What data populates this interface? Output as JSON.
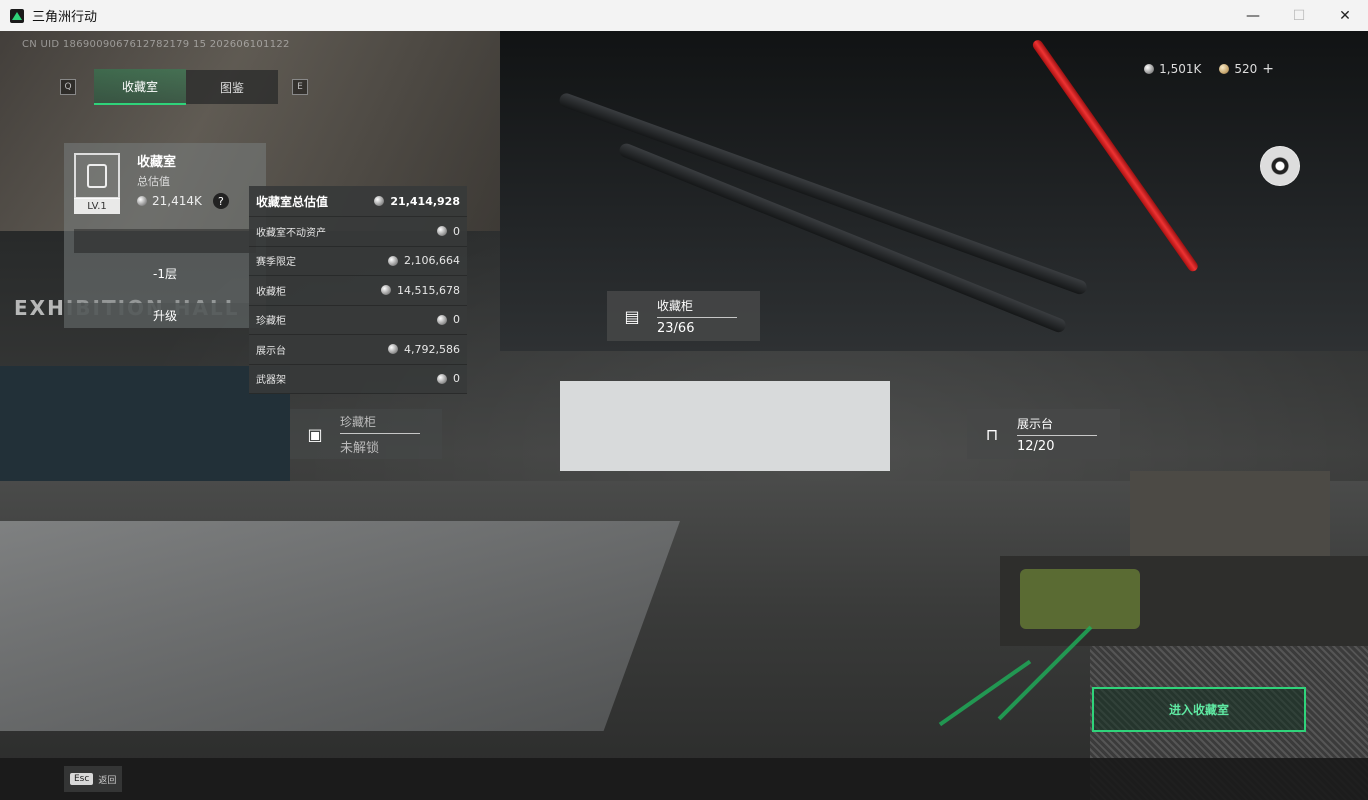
{
  "window": {
    "title": "三角洲行动"
  },
  "uid": "CN UID 1869009067612782179 15 202606101122",
  "currency": {
    "silver": "1,501K",
    "gold": "520",
    "add": "+"
  },
  "tabs": {
    "left_key": "Q",
    "items": [
      "收藏室",
      "图鉴"
    ],
    "right_key": "E",
    "active": 0
  },
  "vault": {
    "title": "收藏室",
    "subtitle": "总估值",
    "level": "LV.1",
    "value": "21,414K",
    "help": "?",
    "progress": 0.0,
    "floor": "-1层",
    "upgrade": "升级"
  },
  "valuation": {
    "title": "收藏室总估值",
    "total": "21,414,928",
    "rows": [
      {
        "label": "收藏室不动资产",
        "value": "0"
      },
      {
        "label": "赛季限定",
        "value": "2,106,664"
      },
      {
        "label": "收藏柜",
        "value": "14,515,678"
      },
      {
        "label": "珍藏柜",
        "value": "0"
      },
      {
        "label": "展示台",
        "value": "4,792,586"
      },
      {
        "label": "武器架",
        "value": "0"
      }
    ]
  },
  "hotspots": [
    {
      "title": "收藏柜",
      "value": "23/66",
      "icon": "cabinet-icon"
    },
    {
      "title": "珍藏柜",
      "value": "未解锁",
      "icon": "safe-icon"
    },
    {
      "title": "展示台",
      "value": "12/20",
      "icon": "display-stand-icon"
    }
  ],
  "scene_text": "EXHIBITION HALL",
  "enter_button": "进入收藏室",
  "esc": {
    "key": "Esc",
    "label": "返回"
  },
  "colors": {
    "accent": "#2fd37a"
  }
}
